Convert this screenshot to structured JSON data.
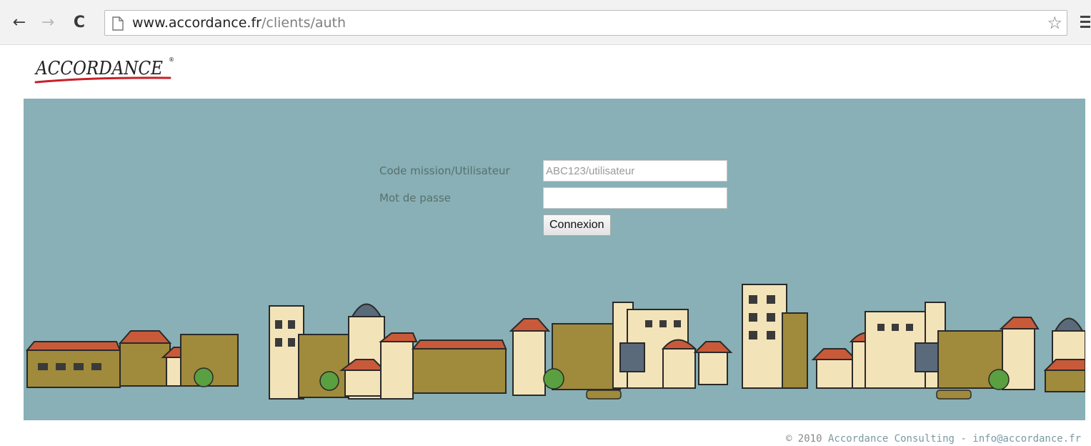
{
  "browser": {
    "url_domain": "www.accordance.fr",
    "url_path": "/clients/auth",
    "icons": {
      "back": "arrow-left-icon",
      "forward": "arrow-right-icon",
      "reload": "reload-icon",
      "page": "page-icon",
      "bookmark": "star-icon",
      "menu": "hamburger-menu-icon"
    }
  },
  "logo": {
    "text": "ACCORDANCE",
    "mark": "®"
  },
  "form": {
    "user_label": "Code mission/Utilisateur",
    "user_placeholder": "ABC123/utilisateur",
    "user_value": "",
    "password_label": "Mot de passe",
    "password_value": "",
    "submit_label": "Connexion"
  },
  "footer": {
    "copyright": "© 2010 ",
    "company": "Accordance Consulting",
    "separator": " - ",
    "email": "info@accordance.fr"
  },
  "colors": {
    "banner_bg": "#88b0b6",
    "label_text": "#58706c",
    "logo_accent": "#c8202a",
    "building_ochre": "#a08a3c",
    "building_cream": "#f3e3b8",
    "roof_red": "#c85a3a",
    "tree_green": "#5aa040"
  }
}
